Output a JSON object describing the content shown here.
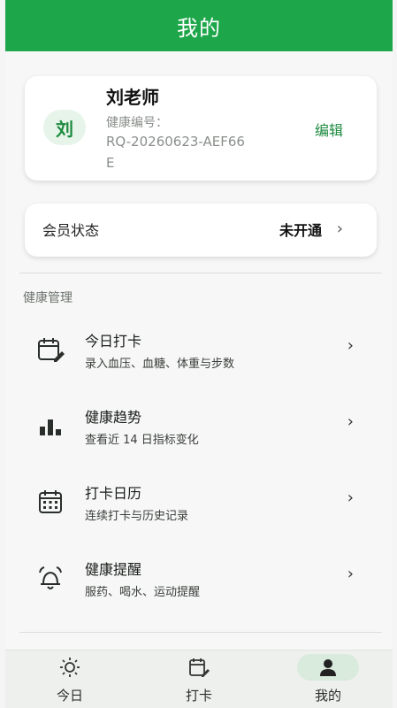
{
  "header": {
    "title": "我的"
  },
  "profile": {
    "avatar_text": "刘",
    "name": "刘老师",
    "id_label": "健康编号：",
    "id_value": "RQ-20260623-AEF66E",
    "edit_label": "编辑"
  },
  "membership": {
    "label": "会员状态",
    "value": "未开通"
  },
  "section": {
    "title": "健康管理"
  },
  "menu": [
    {
      "icon": "calendar-edit-icon",
      "title": "今日打卡",
      "subtitle": "录入血压、血糖、体重与步数"
    },
    {
      "icon": "bar-chart-icon",
      "title": "健康趋势",
      "subtitle": "查看近 14 日指标变化"
    },
    {
      "icon": "calendar-grid-icon",
      "title": "打卡日历",
      "subtitle": "连续打卡与历史记录"
    },
    {
      "icon": "alarm-bell-icon",
      "title": "健康提醒",
      "subtitle": "服药、喝水、运动提醒"
    }
  ],
  "tabs": [
    {
      "icon": "sun-icon",
      "label": "今日"
    },
    {
      "icon": "calendar-edit-icon",
      "label": "打卡"
    },
    {
      "icon": "person-icon",
      "label": "我的"
    }
  ],
  "colors": {
    "brand": "#1ea64a",
    "accent_text": "#1c8a3e",
    "active_tab_bg": "#d8ebdc"
  }
}
